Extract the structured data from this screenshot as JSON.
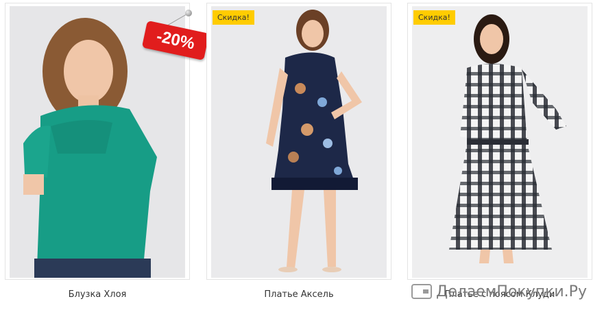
{
  "products": [
    {
      "name": "Блузка Хлоя",
      "discount_tag": "-20%"
    },
    {
      "name": "Платье Аксель",
      "badge": "Скидка!"
    },
    {
      "name": "Платье с поясом Клуди",
      "badge": "Скидка!"
    }
  ],
  "watermark": "ДелаемПокупки.Ру",
  "colors": {
    "badge": "#ffcc00",
    "discount": "#e11d1d"
  }
}
